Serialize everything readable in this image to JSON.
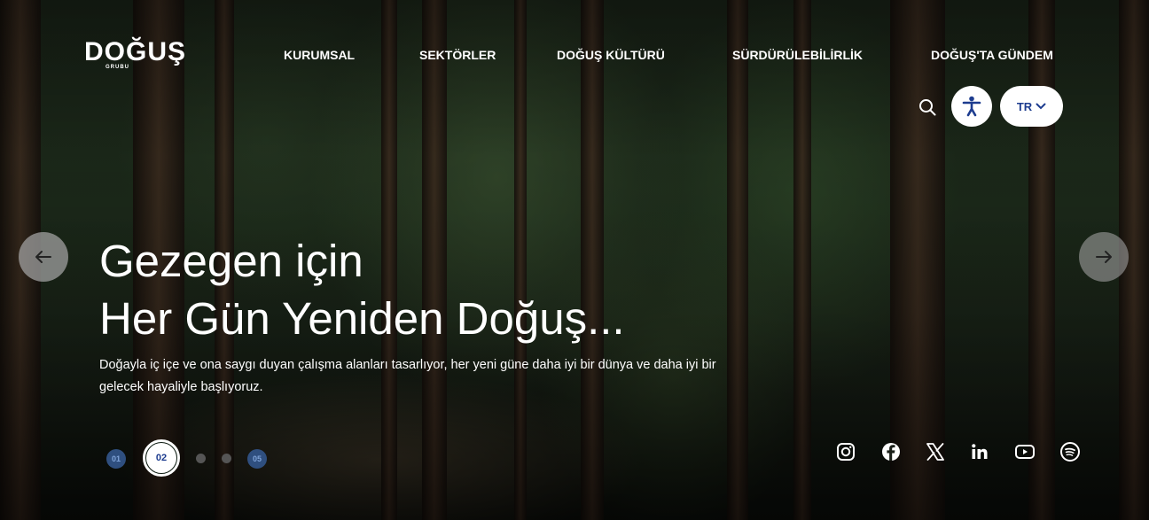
{
  "brand": {
    "name": "DOĞUŞ",
    "sub": "GRUBU"
  },
  "nav": {
    "items": [
      {
        "label": "KURUMSAL"
      },
      {
        "label": "SEKTÖRLER"
      },
      {
        "label": "DOĞUŞ KÜLTÜRÜ"
      },
      {
        "label": "SÜRDÜRÜLEBİLİRLİK"
      },
      {
        "label": "DOĞUŞ'TA GÜNDEM"
      }
    ]
  },
  "header": {
    "language": "TR"
  },
  "hero": {
    "headline_line1": "Gezegen için",
    "headline_line2": "Her Gün Yeniden Doğuş...",
    "description": "Doğayla iç içe ve ona saygı duyan çalışma alanları tasarlıyor, her yeni güne daha iyi bir dünya ve daha iyi bir gelecek hayaliyle başlıyoruz."
  },
  "pager": {
    "first": "01",
    "current": "02",
    "last": "05"
  },
  "social": {
    "icons": [
      "instagram-icon",
      "facebook-icon",
      "x-twitter-icon",
      "linkedin-icon",
      "youtube-icon",
      "spotify-icon"
    ]
  },
  "colors": {
    "accent": "#1d3c8f",
    "pager_dot": "#2f4f7f"
  }
}
